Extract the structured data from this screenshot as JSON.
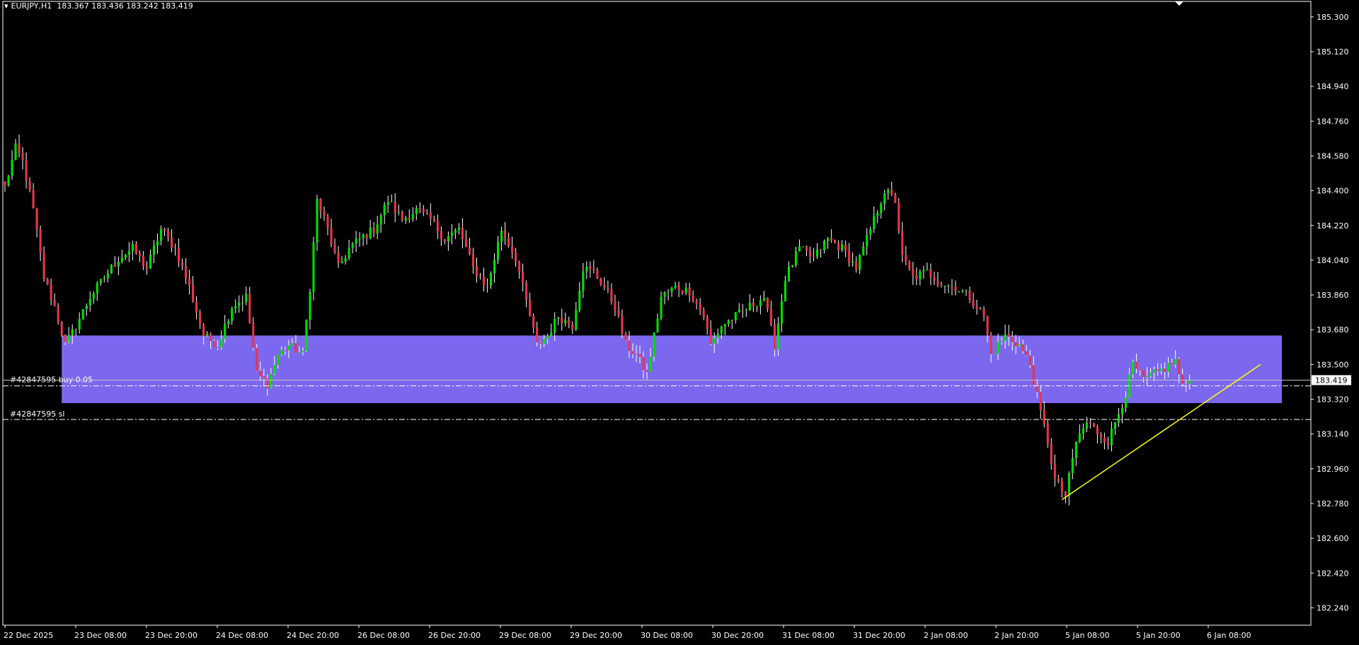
{
  "header": {
    "symbol": "EURJPY,H1",
    "ohlc": "183.367 183.436 183.242 183.419"
  },
  "orders": {
    "buy_label": "#42847595 buy 0.05",
    "sl_label": "#42847595 sl",
    "buy_price": 183.389,
    "sl_price": 183.215
  },
  "colors": {
    "background": "#000000",
    "bull": "#00e000",
    "bear": "#e8344a",
    "zone": "#7b68ee",
    "trendline": "#ffff00",
    "axis": "#ffffff"
  },
  "chart_data": {
    "type": "candlestick",
    "symbol": "EURJPY",
    "timeframe": "H1",
    "ylim": [
      182.15,
      185.38
    ],
    "y_ticks": [
      "185.300",
      "185.120",
      "184.940",
      "184.760",
      "184.580",
      "184.400",
      "184.220",
      "184.040",
      "183.860",
      "183.680",
      "183.500",
      "183.320",
      "183.140",
      "182.960",
      "182.780",
      "182.600",
      "182.420",
      "182.240"
    ],
    "x_ticks": [
      "22 Dec 2025",
      "23 Dec 08:00",
      "23 Dec 20:00",
      "24 Dec 08:00",
      "24 Dec 20:00",
      "26 Dec 08:00",
      "26 Dec 20:00",
      "29 Dec 08:00",
      "29 Dec 20:00",
      "30 Dec 08:00",
      "30 Dec 20:00",
      "31 Dec 08:00",
      "31 Dec 20:00",
      "2 Jan 08:00",
      "2 Jan 20:00",
      "5 Jan 08:00",
      "5 Jan 20:00",
      "6 Jan 08:00"
    ],
    "current_price": "183.419",
    "zone": {
      "from_index": 16,
      "to_index": 360,
      "top": 183.65,
      "bottom": 183.3
    },
    "trendline": {
      "from_index": 298,
      "from_price": 182.8,
      "to_index": 354,
      "to_price": 183.5
    },
    "anchors": [
      [
        0,
        184.42
      ],
      [
        3,
        184.62
      ],
      [
        5,
        184.55
      ],
      [
        8,
        184.3
      ],
      [
        11,
        183.95
      ],
      [
        14,
        183.8
      ],
      [
        17,
        183.6
      ],
      [
        20,
        183.7
      ],
      [
        24,
        183.85
      ],
      [
        28,
        183.95
      ],
      [
        32,
        184.05
      ],
      [
        36,
        184.1
      ],
      [
        40,
        184.0
      ],
      [
        44,
        184.2
      ],
      [
        48,
        184.1
      ],
      [
        52,
        183.9
      ],
      [
        56,
        183.65
      ],
      [
        60,
        183.6
      ],
      [
        64,
        183.8
      ],
      [
        68,
        183.85
      ],
      [
        71,
        183.45
      ],
      [
        74,
        183.4
      ],
      [
        77,
        183.55
      ],
      [
        80,
        183.6
      ],
      [
        84,
        183.55
      ],
      [
        86,
        183.9
      ],
      [
        88,
        184.35
      ],
      [
        91,
        184.2
      ],
      [
        94,
        184.0
      ],
      [
        97,
        184.1
      ],
      [
        100,
        184.15
      ],
      [
        104,
        184.2
      ],
      [
        108,
        184.35
      ],
      [
        112,
        184.25
      ],
      [
        116,
        184.3
      ],
      [
        120,
        184.25
      ],
      [
        124,
        184.15
      ],
      [
        128,
        184.2
      ],
      [
        132,
        184.0
      ],
      [
        136,
        183.9
      ],
      [
        140,
        184.2
      ],
      [
        144,
        184.05
      ],
      [
        148,
        183.75
      ],
      [
        150,
        183.6
      ],
      [
        153,
        183.65
      ],
      [
        156,
        183.75
      ],
      [
        160,
        183.7
      ],
      [
        163,
        184.0
      ],
      [
        166,
        183.98
      ],
      [
        169,
        183.9
      ],
      [
        172,
        183.8
      ],
      [
        175,
        183.6
      ],
      [
        178,
        183.55
      ],
      [
        181,
        183.45
      ],
      [
        185,
        183.85
      ],
      [
        189,
        183.9
      ],
      [
        193,
        183.88
      ],
      [
        197,
        183.75
      ],
      [
        199,
        183.6
      ],
      [
        202,
        183.7
      ],
      [
        206,
        183.75
      ],
      [
        210,
        183.8
      ],
      [
        214,
        183.85
      ],
      [
        217,
        183.6
      ],
      [
        220,
        183.95
      ],
      [
        224,
        184.1
      ],
      [
        228,
        184.05
      ],
      [
        232,
        184.15
      ],
      [
        236,
        184.1
      ],
      [
        240,
        184.0
      ],
      [
        244,
        184.2
      ],
      [
        248,
        184.4
      ],
      [
        251,
        184.35
      ],
      [
        253,
        184.05
      ],
      [
        256,
        183.95
      ],
      [
        260,
        183.98
      ],
      [
        264,
        183.92
      ],
      [
        268,
        183.9
      ],
      [
        272,
        183.85
      ],
      [
        276,
        183.75
      ],
      [
        278,
        183.55
      ],
      [
        282,
        183.65
      ],
      [
        286,
        183.6
      ],
      [
        289,
        183.5
      ],
      [
        292,
        183.25
      ],
      [
        294,
        183.1
      ],
      [
        296,
        182.9
      ],
      [
        299,
        182.82
      ],
      [
        302,
        183.1
      ],
      [
        305,
        183.2
      ],
      [
        308,
        183.15
      ],
      [
        311,
        183.1
      ],
      [
        314,
        183.25
      ],
      [
        316,
        183.35
      ],
      [
        318,
        183.5
      ],
      [
        321,
        183.42
      ],
      [
        324,
        183.45
      ],
      [
        327,
        183.48
      ],
      [
        330,
        183.52
      ],
      [
        332,
        183.38
      ],
      [
        334,
        183.42
      ]
    ]
  }
}
